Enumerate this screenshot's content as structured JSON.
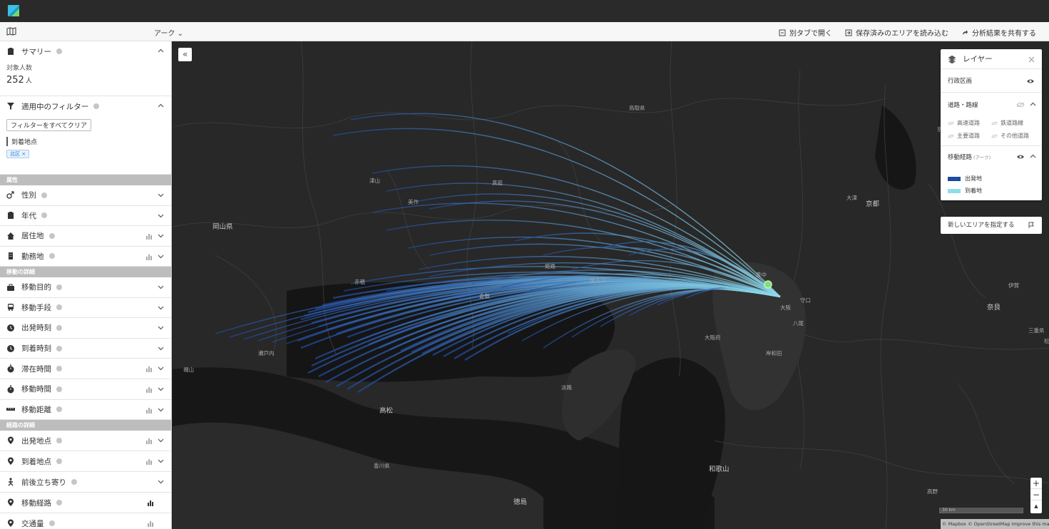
{
  "toolbar": {
    "mode_label": "アーク ⌄",
    "open_tab": "別タブで開く",
    "load_area": "保存済みのエリアを読み込む",
    "share": "分析結果を共有する"
  },
  "sidebar": {
    "summary": {
      "title": "サマリー",
      "count_label": "対象人数",
      "count": "252",
      "unit": "人"
    },
    "filters": {
      "title": "適用中のフィルター",
      "clear": "フィルターをすべてクリア",
      "item": "到着地点",
      "chip": "北区 ×"
    },
    "groups": {
      "attributes": "属性",
      "movement": "移動の詳細",
      "route": "経路の詳細"
    },
    "attribute_items": [
      "性別",
      "年代",
      "居住地",
      "勤務地"
    ],
    "movement_items": [
      "移動目的",
      "移動手段",
      "出発時刻",
      "到着時刻",
      "滞在時間",
      "移動時間",
      "移動距離"
    ],
    "route_items": [
      "出発地点",
      "到着地点",
      "前後立ち寄り",
      "移動経路",
      "交通量"
    ]
  },
  "layers": {
    "title": "レイヤー",
    "admin": "行政区画",
    "roads": "道路・路線",
    "road_types": [
      "高速道路",
      "鉄道路線",
      "主要道路",
      "その他道路"
    ],
    "routes": "移動経路",
    "routes_sub": "(アーク)",
    "legend": [
      {
        "label": "出発地",
        "color": "#1f4aa0"
      },
      {
        "label": "到着地",
        "color": "#8fdcea"
      }
    ]
  },
  "new_area": "新しいエリアを指定する",
  "zoom": {
    "in": "+",
    "out": "−",
    "north": "▲"
  },
  "scale": "30 km",
  "attribution": "© Mapbox © OpenStreetMap Improve this map",
  "place_labels": [
    {
      "text": "岡山県",
      "big": true
    },
    {
      "text": "大阪府",
      "big": false
    },
    {
      "text": "大阪",
      "big": false
    },
    {
      "text": "京都",
      "big": true
    },
    {
      "text": "奈良",
      "big": true
    },
    {
      "text": "高松",
      "big": true
    },
    {
      "text": "和歌山",
      "big": true
    },
    {
      "text": "徳島",
      "big": true
    },
    {
      "text": "姫路",
      "big": false
    },
    {
      "text": "香川県",
      "big": false
    },
    {
      "text": "福山",
      "big": false
    },
    {
      "text": "津山",
      "big": false
    },
    {
      "text": "大津",
      "big": false
    },
    {
      "text": "美作",
      "big": false
    },
    {
      "text": "赤穂",
      "big": false
    },
    {
      "text": "加古川",
      "big": false
    },
    {
      "text": "豊中",
      "big": false
    },
    {
      "text": "高野",
      "big": false
    },
    {
      "text": "京都府",
      "big": false
    },
    {
      "text": "三重県",
      "big": false
    },
    {
      "text": "伊賀",
      "big": false
    },
    {
      "text": "松阪",
      "big": false
    },
    {
      "text": "守口",
      "big": false
    },
    {
      "text": "八尾",
      "big": false
    },
    {
      "text": "岸和田",
      "big": false
    },
    {
      "text": "鳥取県",
      "big": false
    },
    {
      "text": "真庭",
      "big": false
    },
    {
      "text": "倉敷",
      "big": false
    },
    {
      "text": "瀬戸内",
      "big": false
    },
    {
      "text": "淡路",
      "big": false
    }
  ]
}
